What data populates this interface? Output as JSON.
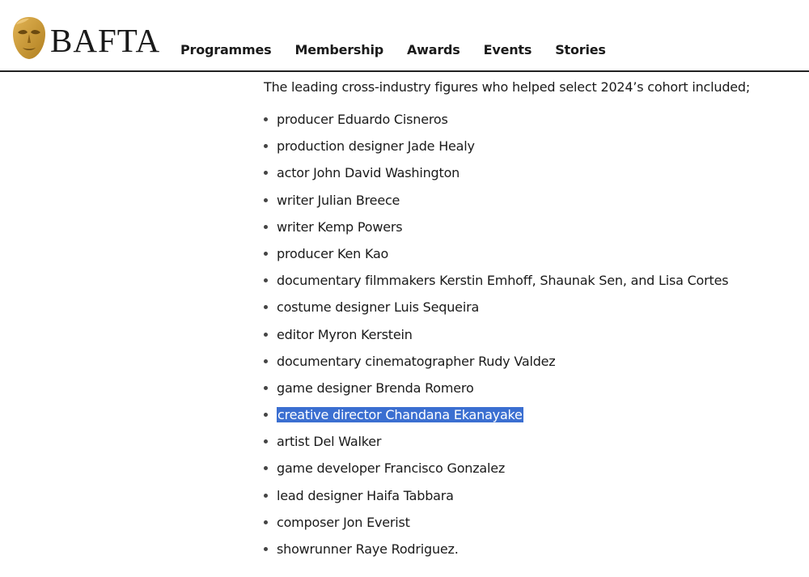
{
  "brand": {
    "name": "BAFTA",
    "mask_color": "#c8962e"
  },
  "nav": {
    "items": [
      {
        "label": "Programmes"
      },
      {
        "label": "Membership"
      },
      {
        "label": "Awards"
      },
      {
        "label": "Events"
      },
      {
        "label": "Stories"
      }
    ]
  },
  "article": {
    "intro": "The leading cross-industry figures who helped select 2024’s cohort included;",
    "items": [
      {
        "text": "producer Eduardo Cisneros"
      },
      {
        "text": "production designer Jade Healy"
      },
      {
        "text": "actor John David Washington"
      },
      {
        "text": "writer Julian Breece"
      },
      {
        "text": "writer Kemp Powers"
      },
      {
        "text": "producer Ken Kao"
      },
      {
        "text": "documentary filmmakers Kerstin Emhoff, Shaunak Sen, and Lisa Cortes"
      },
      {
        "text": "costume designer Luis Sequeira"
      },
      {
        "text": "editor Myron Kerstein"
      },
      {
        "text": "documentary cinematographer Rudy Valdez"
      },
      {
        "text": "game designer Brenda Romero"
      },
      {
        "text": "creative director Chandana Ekanayake",
        "selected": true
      },
      {
        "text": "artist Del Walker"
      },
      {
        "text": "game developer Francisco Gonzalez"
      },
      {
        "text": "lead designer Haifa Tabbara"
      },
      {
        "text": "composer Jon Everist"
      },
      {
        "text": "showrunner Raye Rodriguez."
      }
    ]
  },
  "colors": {
    "selection": "#3b6fd1",
    "header_rule": "#222222"
  }
}
